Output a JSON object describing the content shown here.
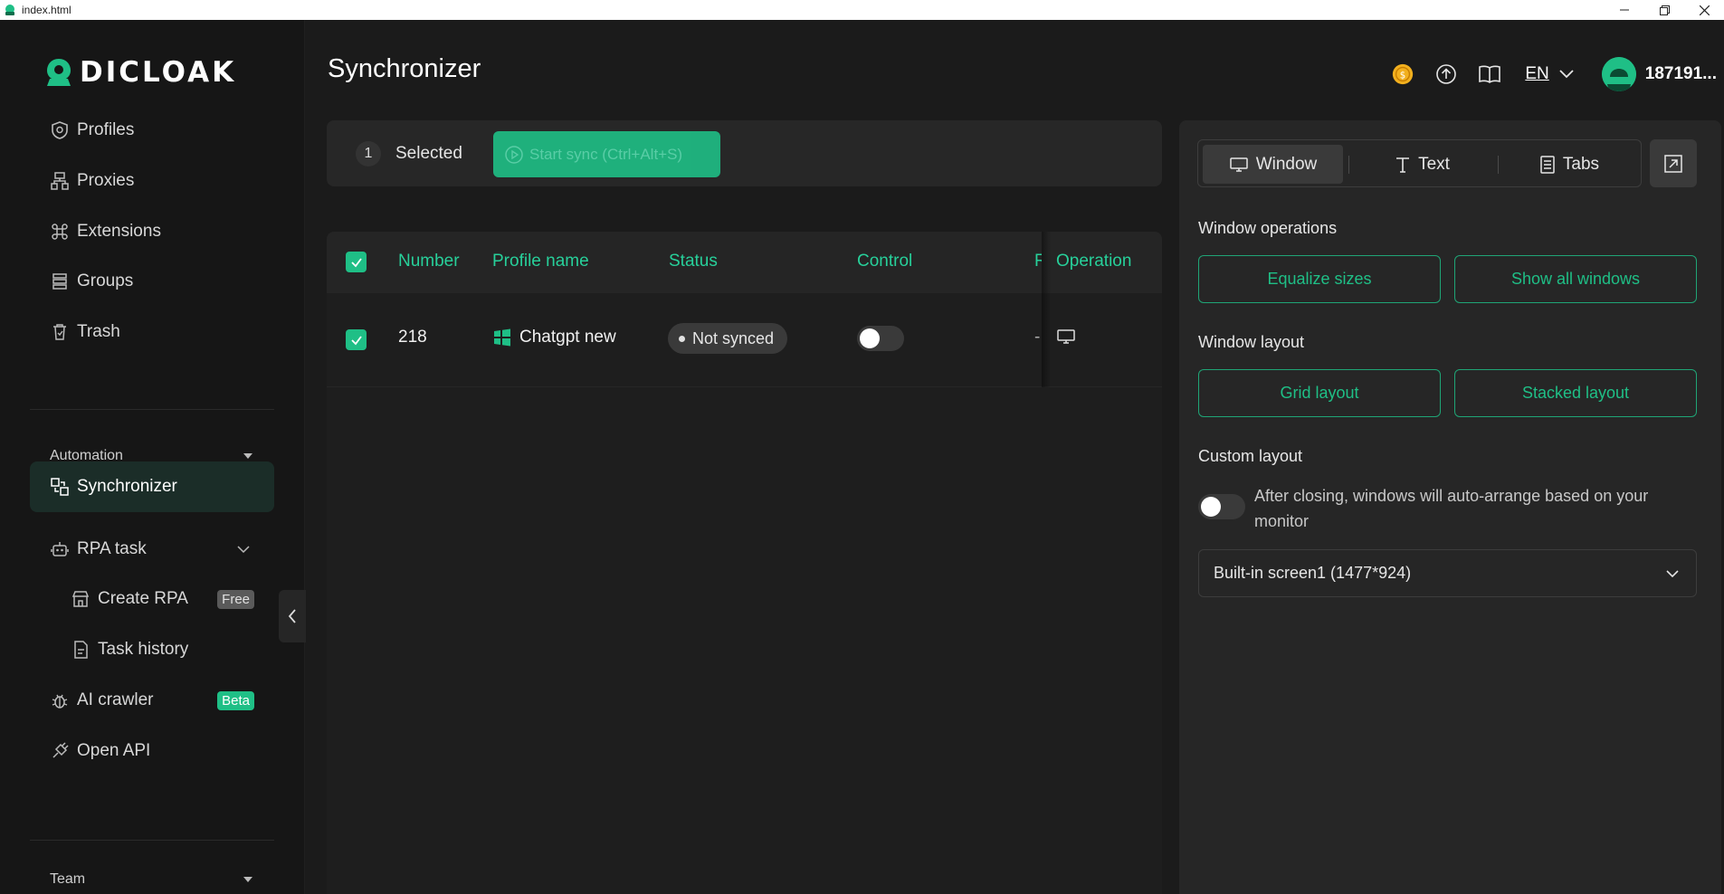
{
  "window": {
    "title": "index.html"
  },
  "brand": {
    "name": "DICLOAK",
    "color": "#1fbf86"
  },
  "sidebar": {
    "items": [
      {
        "label": "Profiles",
        "icon": "chrome-shield-icon"
      },
      {
        "label": "Proxies",
        "icon": "network-icon"
      },
      {
        "label": "Extensions",
        "icon": "command-icon"
      },
      {
        "label": "Groups",
        "icon": "stack-icon"
      },
      {
        "label": "Trash",
        "icon": "trash-icon"
      }
    ],
    "automation_label": "Automation",
    "synchronizer_label": "Synchronizer",
    "rpa_label": "RPA task",
    "create_rpa_label": "Create RPA",
    "free_badge": "Free",
    "task_history_label": "Task history",
    "ai_crawler_label": "AI crawler",
    "beta_badge": "Beta",
    "open_api_label": "Open API",
    "team_label": "Team"
  },
  "header": {
    "title": "Synchronizer",
    "language": "EN",
    "username": "187191..."
  },
  "selection": {
    "count": "1",
    "label": "Selected",
    "start_sync_label": "Start sync (Ctrl+Alt+S)"
  },
  "table": {
    "columns": [
      "Number",
      "Profile name",
      "Status",
      "Control",
      "R",
      "Operation"
    ],
    "rows": [
      {
        "checked": true,
        "number": "218",
        "profile_name": "Chatgpt new",
        "status": "Not synced",
        "control_on": false,
        "r_value": "-"
      }
    ]
  },
  "panel": {
    "tabs": [
      "Window",
      "Text",
      "Tabs"
    ],
    "active_tab": "Window",
    "window_operations_label": "Window operations",
    "equalize_label": "Equalize sizes",
    "show_all_label": "Show all windows",
    "window_layout_label": "Window layout",
    "grid_label": "Grid layout",
    "stacked_label": "Stacked layout",
    "custom_layout_label": "Custom layout",
    "custom_desc": "After closing, windows will auto-arrange based on your monitor",
    "custom_toggle_on": false,
    "screen_select_value": "Built-in screen1 (1477*924)"
  }
}
